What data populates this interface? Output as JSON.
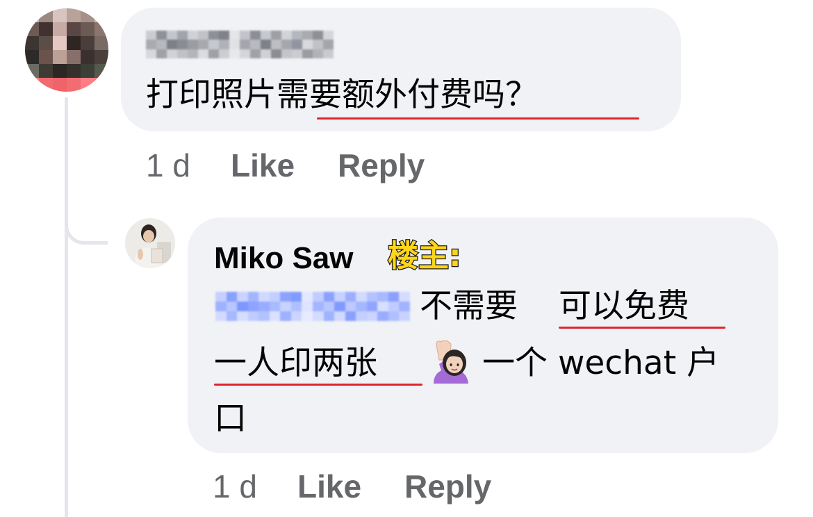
{
  "comment": {
    "text_plain": "打印照片",
    "text_underlined": "需要额外付费吗？",
    "time": "1 d",
    "like_label": "Like",
    "reply_label": "Reply"
  },
  "reply": {
    "author": "Miko Saw",
    "badge": "楼主:",
    "line1_a": "不需要",
    "line1_b": "可以免费",
    "line2_a": "一人印两张",
    "line2_b": "一个 wechat 户",
    "line3": "口",
    "emoji": "raising-hand-emoji",
    "time": "1 d",
    "like_label": "Like",
    "reply_label": "Reply"
  },
  "colors": {
    "bubble": "#f0f2f5",
    "meta_text": "#65676b",
    "underline": "#e0242f",
    "badge_fill": "#ffd51a",
    "thread_line": "#e4e6eb"
  }
}
